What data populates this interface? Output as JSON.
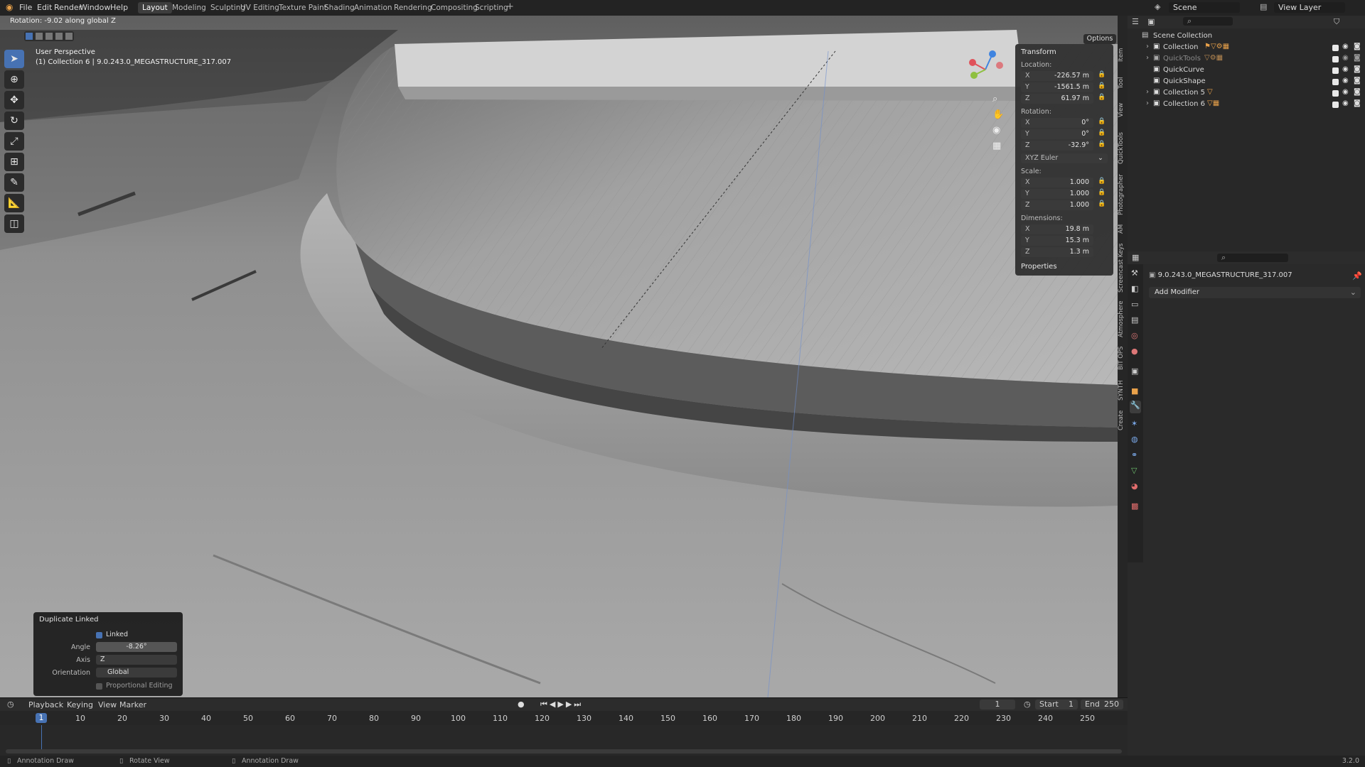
{
  "menu": {
    "file": "File",
    "edit": "Edit",
    "render": "Render",
    "window": "Window",
    "help": "Help"
  },
  "workspaces": [
    "Layout",
    "Modeling",
    "Sculpting",
    "UV Editing",
    "Texture Paint",
    "Shading",
    "Animation",
    "Rendering",
    "Compositing",
    "Scripting"
  ],
  "active_workspace": "Layout",
  "scene": {
    "name": "Scene",
    "view_layer": "View Layer"
  },
  "header_info": "Rotation: -9.02 along global Z",
  "viewport": {
    "perspective": "User Perspective",
    "object_info": "(1) Collection 6 | 9.0.243.0_MEGASTRUCTURE_317.007",
    "options": "Options"
  },
  "transform_panel": {
    "title": "Transform",
    "location_label": "Location:",
    "location": {
      "x": "-226.57 m",
      "y": "-1561.5 m",
      "z": "61.97 m"
    },
    "rotation_label": "Rotation:",
    "rotation": {
      "x": "0°",
      "y": "0°",
      "z": "-32.9°"
    },
    "rotation_mode": "XYZ Euler",
    "scale_label": "Scale:",
    "scale": {
      "x": "1.000",
      "y": "1.000",
      "z": "1.000"
    },
    "dimensions_label": "Dimensions:",
    "dimensions": {
      "x": "19.8 m",
      "y": "15.3 m",
      "z": "1.3 m"
    },
    "properties": "Properties"
  },
  "sidebar_tabs": [
    "Item",
    "Tool",
    "View",
    "QuickTools",
    "Photographer",
    "AM",
    "Screencast Keys",
    "Atmosphere",
    "BIT OPS",
    "SYNTH",
    "Create"
  ],
  "outliner": {
    "root": "Scene Collection",
    "rows": [
      {
        "label": "Collection",
        "dim": false
      },
      {
        "label": "QuickTools",
        "dim": true
      },
      {
        "label": "QuickCurve",
        "dim": false
      },
      {
        "label": "QuickShape",
        "dim": false
      },
      {
        "label": "Collection 5",
        "dim": false
      },
      {
        "label": "Collection 6",
        "dim": false
      }
    ]
  },
  "properties_editor": {
    "object_name": "9.0.243.0_MEGASTRUCTURE_317.007",
    "add_modifier": "Add Modifier"
  },
  "redo_panel": {
    "title": "Duplicate Linked",
    "linked_label": "Linked",
    "linked": true,
    "angle_label": "Angle",
    "angle": "-8.26°",
    "axis_label": "Axis",
    "axis": "Z",
    "orientation_label": "Orientation",
    "orientation": "Global",
    "proportional_label": "Proportional Editing"
  },
  "timeline": {
    "playback": "Playback",
    "keying": "Keying",
    "view": "View",
    "marker": "Marker",
    "current_frame": "1",
    "start_label": "Start",
    "start": "1",
    "end_label": "End",
    "end": "250",
    "ticks": [
      "1",
      "10",
      "20",
      "30",
      "40",
      "50",
      "60",
      "70",
      "80",
      "90",
      "100",
      "110",
      "120",
      "130",
      "140",
      "150",
      "160",
      "170",
      "180",
      "190",
      "200",
      "210",
      "220",
      "230",
      "240",
      "250"
    ]
  },
  "statusbar": {
    "left": "Annotation Draw",
    "middle": "Rotate View",
    "right": "Annotation Draw",
    "version": "3.2.0"
  },
  "icons": [
    "blender-logo-icon",
    "select-box-icon",
    "cursor-icon",
    "move-icon",
    "rotate-icon",
    "scale-icon",
    "transform-icon",
    "annotate-icon",
    "measure-icon",
    "add-cube-icon",
    "zoom-icon",
    "hand-icon",
    "camera-icon",
    "grid-icon",
    "search-icon",
    "filter-icon",
    "eye-icon",
    "camera-toggle-icon",
    "wrench-icon",
    "lock-icon"
  ],
  "colors": {
    "accent": "#4772b3",
    "header": "#232323",
    "panel": "#2d2d2d",
    "gizmo_x": "#e0525a",
    "gizmo_y": "#8fc040",
    "gizmo_z": "#3f84e0"
  }
}
